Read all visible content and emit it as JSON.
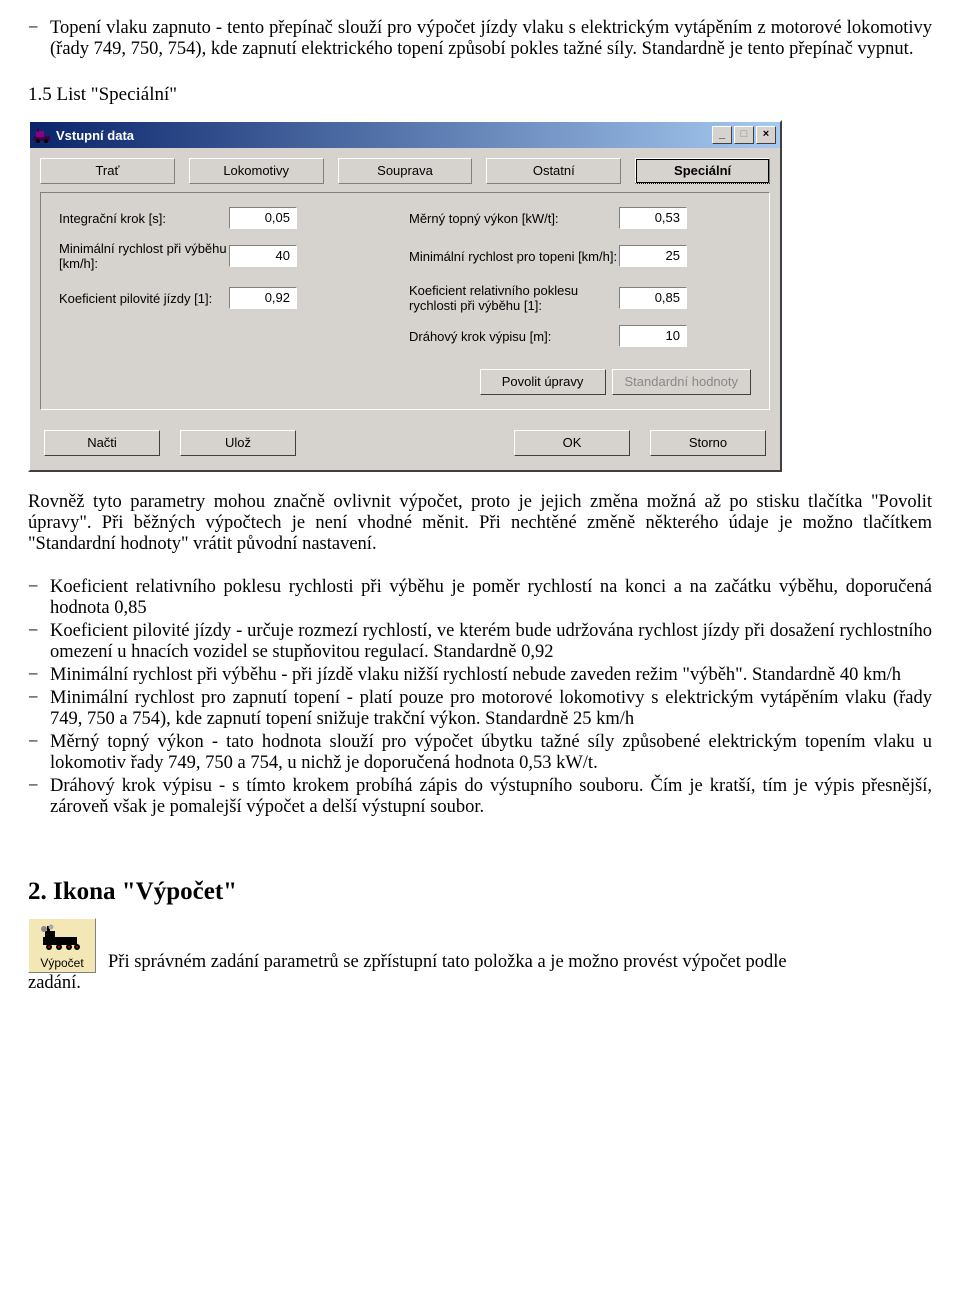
{
  "intro": {
    "bullet_dash": "−",
    "topeni": "Topení vlaku zapnuto - tento přepínač slouží pro výpočet jízdy vlaku s elektrickým vytápěním z motorové lokomotivy (řady 749, 750, 754), kde zapnutí elektrického topení způsobí pokles tažné síly. Standardně je tento přepínač vypnut."
  },
  "section_heading": "1.5 List \"Speciální\"",
  "window": {
    "title": "Vstupní data",
    "btn_min": "_",
    "btn_max": "□",
    "btn_close": "×",
    "tabs": [
      "Trať",
      "Lokomotivy",
      "Souprava",
      "Ostatní",
      "Speciální"
    ],
    "fields": {
      "l1_label": "Integrační krok [s]:",
      "l1_value": "0,05",
      "l2_label": "Minimální rychlost při výběhu [km/h]:",
      "l2_value": "40",
      "l3_label": "Koeficient pilovité jízdy [1]:",
      "l3_value": "0,92",
      "r1_label": "Měrný topný výkon [kW/t]:",
      "r1_value": "0,53",
      "r2_label": "Minimální rychlost pro topeni [km/h]:",
      "r2_value": "25",
      "r3_label": "Koeficient relativního poklesu rychlosti při výběhu [1]:",
      "r3_value": "0,85",
      "r4_label": "Dráhový krok výpisu [m]:",
      "r4_value": "10"
    },
    "buttons": {
      "povolit": "Povolit úpravy",
      "standard": "Standardní hodnoty",
      "nacti": "Načti",
      "uloz": "Ulož",
      "ok": "OK",
      "storno": "Storno"
    }
  },
  "after_window": "Rovněž tyto parametry mohou značně ovlivnit výpočet, proto je jejich změna možná až po stisku tlačítka \"Povolit úpravy\". Při běžných výpočtech je není vhodné měnit. Při nechtěné změně některého údaje je možno tlačítkem \"Standardní hodnoty\" vrátit původní nastavení.",
  "bullets": [
    "Koeficient relativního poklesu rychlosti při výběhu je poměr rychlostí na konci a na začátku výběhu, doporučená hodnota 0,85",
    "Koeficient pilovité jízdy - určuje rozmezí rychlostí, ve kterém bude udržována rychlost jízdy při dosažení rychlostního omezení u hnacích vozidel se stupňovitou regulací. Standardně 0,92",
    "Minimální rychlost při výběhu - při jízdě vlaku nižší rychlostí nebude zaveden režim \"výběh\". Standardně 40 km/h",
    "Minimální rychlost pro zapnutí topení - platí pouze pro motorové lokomotivy s elektrickým vytápěním vlaku (řady 749, 750 a 754), kde zapnutí topení snižuje trakční výkon. Standardně 25 km/h",
    "Měrný topný výkon - tato hodnota slouží pro výpočet úbytku tažné síly způsobené elektrickým topením vlaku u lokomotiv řady 749, 750 a 754, u nichž je doporučená hodnota 0,53 kW/t.",
    "Dráhový krok výpisu - s tímto krokem probíhá zápis do výstupního souboru. Čím je kratší, tím je výpis přesnější, zároveň však je pomalejší výpočet a delší výstupní soubor."
  ],
  "section2": {
    "heading": "2. Ikona \"Výpočet\"",
    "icon_caption": "Výpočet",
    "text_line": "Při správném zadání parametrů se zpřístupní tato položka a je možno provést výpočet podle",
    "text_tail": "zadání."
  }
}
